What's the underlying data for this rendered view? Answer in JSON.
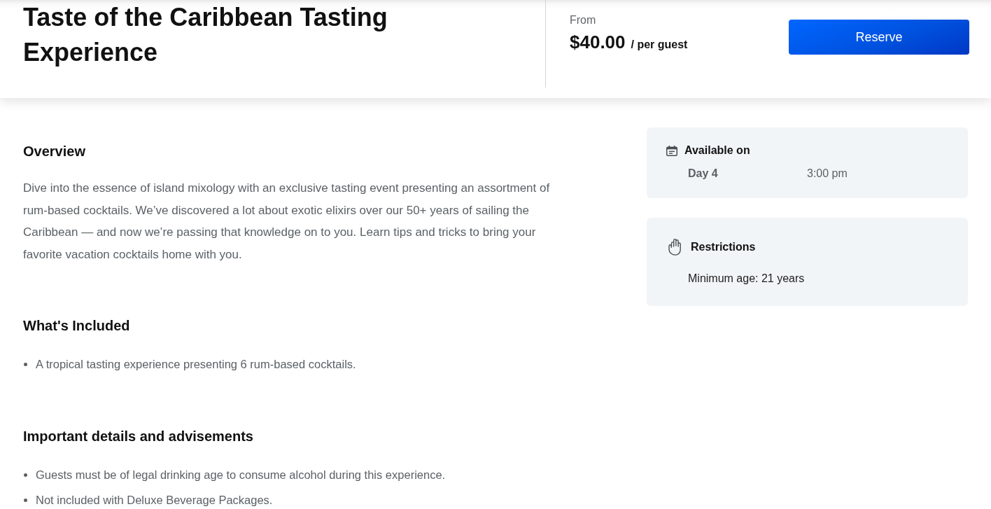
{
  "header": {
    "title": "Taste of the Caribbean Tasting Experience",
    "price_label": "From",
    "price": "$40.00",
    "price_unit": "/ per guest",
    "reserve_button": "Reserve"
  },
  "sections": [
    {
      "kind": "paragraph",
      "heading": "Overview",
      "text": "Dive into the essence of island mixology with an exclusive tasting event presenting an assortment of rum-based cocktails. We’ve discovered a lot about exotic elixirs over our 50+ years of sailing the Caribbean — and now we’re passing that knowledge on to you. Learn tips and tricks to bring your favorite vacation cocktails home with you."
    },
    {
      "kind": "list",
      "heading": "What's Included",
      "items": [
        "A tropical tasting experience presenting 6 rum-based cocktails."
      ]
    },
    {
      "kind": "list",
      "heading": "Important details and advisements",
      "items": [
        "Guests must be of legal drinking age to consume alcohol during this experience.",
        "Not included with Deluxe Beverage Packages."
      ]
    }
  ],
  "sidebar": [
    {
      "kind": "availability",
      "title": "Available on",
      "day": "Day 4",
      "time": "3:00 pm"
    },
    {
      "kind": "restrictions",
      "title": "Restrictions",
      "text": "Minimum age: 21 years"
    }
  ]
}
